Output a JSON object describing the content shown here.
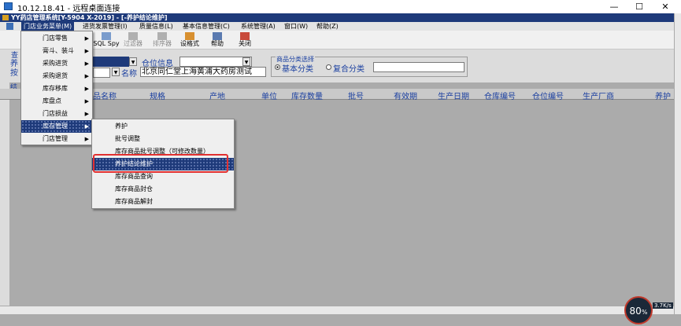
{
  "rdp": {
    "title": "10.12.18.41 - 远程桌面连接"
  },
  "app": {
    "title": "YY药店管理系统[Y-5904 X-2019] - [-养护结论维护]"
  },
  "menubar": [
    "门店业务菜单(M)",
    "进货发票管理(I)",
    "质量信息(L)",
    "基本信息管理(C)",
    "系统管理(A)",
    "窗口(W)",
    "帮助(Z)"
  ],
  "toolbar": [
    {
      "label": "SQL Spy",
      "disabled": false
    },
    {
      "label": "过滤器",
      "disabled": true
    },
    {
      "label": "排序器",
      "disabled": true
    },
    {
      "label": "设格式",
      "disabled": false
    },
    {
      "label": "帮助",
      "disabled": false
    },
    {
      "label": "关闭",
      "disabled": false
    }
  ],
  "filter": {
    "left_labels": [
      "查",
      "养",
      "按"
    ],
    "warehouse_label": "仓位信息",
    "name_label": "名称",
    "name_value": "北京同仁堂上海黄浦大药房测试",
    "category_group_title": "商品分类选择",
    "radio_basic": "基本分类",
    "radio_composite": "复合分类",
    "row_label": "结"
  },
  "columns": [
    "品名称",
    "规格",
    "产地",
    "单位",
    "库存数量",
    "批号",
    "有效期",
    "生产日期",
    "仓库编号",
    "仓位编号",
    "生产厂商",
    "养护"
  ],
  "menu1": [
    "门店零售",
    "膏斗、装斗",
    "采购进货",
    "采购退货",
    "库存移库",
    "库盘点",
    "门店损益",
    "库存管理",
    "门店管理"
  ],
  "menu2": [
    "养护",
    "批号调整",
    "库存商品批号调整（可修改数量）",
    "养护结论维护",
    "库存商品查询",
    "库存商品封仓",
    "库存商品解封"
  ],
  "zoom": {
    "value": "80",
    "unit": "%",
    "rate": "3.7K/s"
  }
}
